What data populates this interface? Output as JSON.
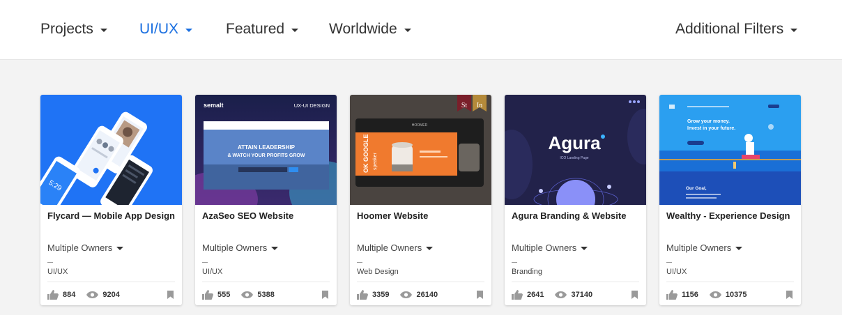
{
  "nav": {
    "projects": "Projects",
    "uiux": "UI/UX",
    "featured": "Featured",
    "worldwide": "Worldwide",
    "additional_filters": "Additional Filters"
  },
  "colors": {
    "accent": "#1a6fe0",
    "background": "#f3f3f3"
  },
  "cards": [
    {
      "title": "Flycard — Mobile App Design",
      "owners": "Multiple Owners",
      "category": "UI/UX",
      "likes": "884",
      "views": "9204",
      "thumb_text": [
        "5:29"
      ]
    },
    {
      "title": "AzaSeo SEO Website",
      "owners": "Multiple Owners",
      "category": "UI/UX",
      "likes": "555",
      "views": "5388",
      "thumb_text": [
        "semalt",
        "UX-UI DESIGN",
        "ATTAIN LEADERSHIP",
        "& WATCH YOUR PROFITS GROW"
      ]
    },
    {
      "title": "Hoomer Website",
      "owners": "Multiple Owners",
      "category": "Web Design",
      "likes": "3359",
      "views": "26140",
      "thumb_text": [
        "St",
        "In",
        "HOOMER",
        "OK GOOGLE",
        "speaker"
      ]
    },
    {
      "title": "Agura Branding & Website",
      "owners": "Multiple Owners",
      "category": "Branding",
      "likes": "2641",
      "views": "37140",
      "thumb_text": [
        "Agura",
        "ICO Landing Page"
      ]
    },
    {
      "title": "Wealthy - Experience Design",
      "owners": "Multiple Owners",
      "category": "UI/UX",
      "likes": "1156",
      "views": "10375",
      "thumb_text": [
        "Grow your money.",
        "Invest in your future.",
        "Our Goal,"
      ]
    }
  ],
  "icons": {
    "like": "thumbs-up-icon",
    "views": "eye-icon",
    "save": "bookmark-icon",
    "dropdown": "caret-down-icon"
  }
}
